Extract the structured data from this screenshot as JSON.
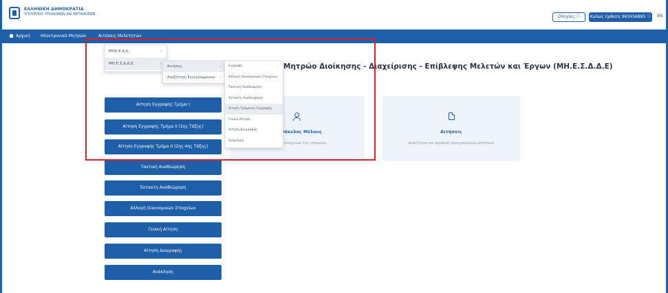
{
  "header": {
    "brand_title": "ΕΛΛΗΝΙΚΗ ΔΗΜΟΚΡΑΤΙΑ",
    "brand_sub": "ΥΠΟΥΡΓΕΙΟ ΥΠΟΔΟΜΩΝ ΚΑΙ ΜΕΤΑΦΟΡΩΝ",
    "help_button": "Οδηγίες ⓘ",
    "user_button": "Καλώς ήρθατε 963456885 ⓘ",
    "lang": "EN"
  },
  "nav": {
    "home": "Αρχική",
    "item2": "Ηλεκτρονικά Μητρώα",
    "item3": "Αιτήσεις Μελετητών"
  },
  "menu_level1": {
    "items": [
      {
        "label": "ΜΗΚ.Ε.Δ.Κ."
      },
      {
        "label": "ΜΗ.Ε.Σ.Δ.Δ.Ε."
      }
    ]
  },
  "menu_level2": {
    "items": [
      {
        "label": "Αιτήσεις"
      },
      {
        "label": "Αναζήτηση Εγγεγραμμένων"
      }
    ]
  },
  "menu_level3": {
    "items": [
      {
        "label": "Εγγραφή"
      },
      {
        "label": "Αλλαγή Οικονομικών Στοιχείων"
      },
      {
        "label": "Τακτική Αναθεώρηση"
      },
      {
        "label": "Έκτακτη Αναθεώρηση"
      },
      {
        "label": "Αίτηση Τμήματος Εγγραφής"
      },
      {
        "label": "Γενική Αίτηση"
      },
      {
        "label": "Αίτηση Διαγραφής"
      },
      {
        "label": "Ανάκληση"
      }
    ]
  },
  "page": {
    "title": "Μητρώο Διοίκησης - Διαχείρισης - Επίβλεψης Μελετών και Έργων (ΜΗ.Ε.Σ.Δ.Δ.Ε)"
  },
  "side_buttons": [
    "Αίτηση Εγγραφής Τμήμα Ι",
    "Αίτηση Εγγραφής Τμήμα ΙΙ (1ης Τάξης)",
    "Αίτηση Εγγραφής Τμήμα ΙΙ (2ης-4ης Τάξης)",
    "Τακτική Αναθεώρηση",
    "Έκτακτη Αναθεώρηση",
    "Αλλαγή Οικονομικών Στοιχείων",
    "Γενική Αίτηση",
    "Αίτηση Διαγραφής",
    "Ανάκληση"
  ],
  "cards": [
    {
      "icon": "user-icon",
      "title": "Φάκελος Μέλους",
      "desc": "Προβολή στοιχείων της εταιρείας"
    },
    {
      "icon": "document-icon",
      "title": "Αιτήσεις",
      "desc": "Αναζήτηση και προβολή προηγούμενων αιτήσεων"
    }
  ]
}
